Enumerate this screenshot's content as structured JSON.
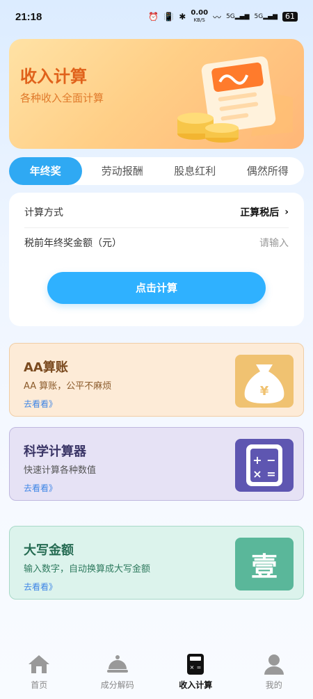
{
  "status_bar": {
    "time": "21:18",
    "network_speed": "0.00",
    "network_unit": "KB/S",
    "signal_labels": [
      "5G",
      "5G"
    ],
    "battery": "61"
  },
  "hero": {
    "title": "收入计算",
    "subtitle": "各种收入全面计算"
  },
  "tabs": [
    {
      "label": "年终奖",
      "active": true
    },
    {
      "label": "劳动报酬",
      "active": false
    },
    {
      "label": "股息红利",
      "active": false
    },
    {
      "label": "偶然所得",
      "active": false
    }
  ],
  "form": {
    "method_label": "计算方式",
    "method_value": "正算税后",
    "amount_label": "税前年终奖金额（元）",
    "amount_placeholder": "请输入",
    "submit_label": "点击计算"
  },
  "features": [
    {
      "title": "AA算账",
      "desc": "AA 算账，公平不麻烦",
      "link": "去看看》",
      "icon": "money-bag-yuan-icon",
      "icon_text": "¥"
    },
    {
      "title": "科学计算器",
      "desc": "快速计算各种数值",
      "link": "去看看》",
      "icon": "calculator-icon"
    },
    {
      "title": "大写金额",
      "desc": "输入数字，自动换算成大写金额",
      "link": "去看看》",
      "icon": "chinese-numeral-icon",
      "icon_text": "壹"
    }
  ],
  "bottom_nav": [
    {
      "label": "首页",
      "icon": "home-icon",
      "active": false
    },
    {
      "label": "成分解码",
      "icon": "cloche-icon",
      "active": false
    },
    {
      "label": "收入计算",
      "icon": "calculator-icon",
      "active": true
    },
    {
      "label": "我的",
      "icon": "user-icon",
      "active": false
    }
  ],
  "colors": {
    "accent": "#2fa9f3",
    "hero_title": "#e0621b",
    "aa_bg": "#fdebd7",
    "sci_bg": "#e6e2f5",
    "amount_bg": "#dcf3ec"
  }
}
